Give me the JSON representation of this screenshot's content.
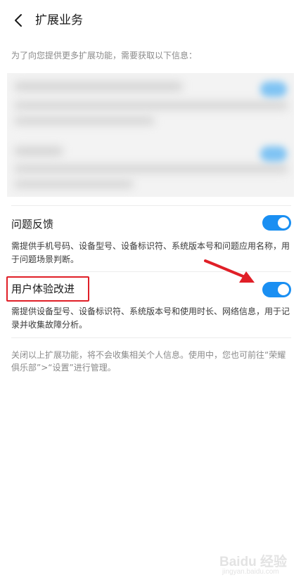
{
  "header": {
    "title": "扩展业务"
  },
  "intro": "为了向您提供更多扩展功能，需要获取以下信息：",
  "settings": [
    {
      "title": "问题反馈",
      "description": "需提供手机号码、设备型号、设备标识符、系统版本号和问题应用名称，用于问题场景判断。",
      "enabled": true
    },
    {
      "title": "用户体验改进",
      "description": "需提供设备型号、设备标识符、系统版本号和使用时长、网络信息，用于记录并收集故障分析。",
      "enabled": true
    }
  ],
  "footer_note": "关闭以上扩展功能，将不会收集相关个人信息。使用中，您也可前往“荣耀俱乐部”>“设置”进行管理。",
  "watermark": {
    "main": "Baidu 经验",
    "sub": "jingyan.baidu.com"
  },
  "colors": {
    "toggle_on": "#1a8ff2",
    "annotation": "#e01f27"
  }
}
